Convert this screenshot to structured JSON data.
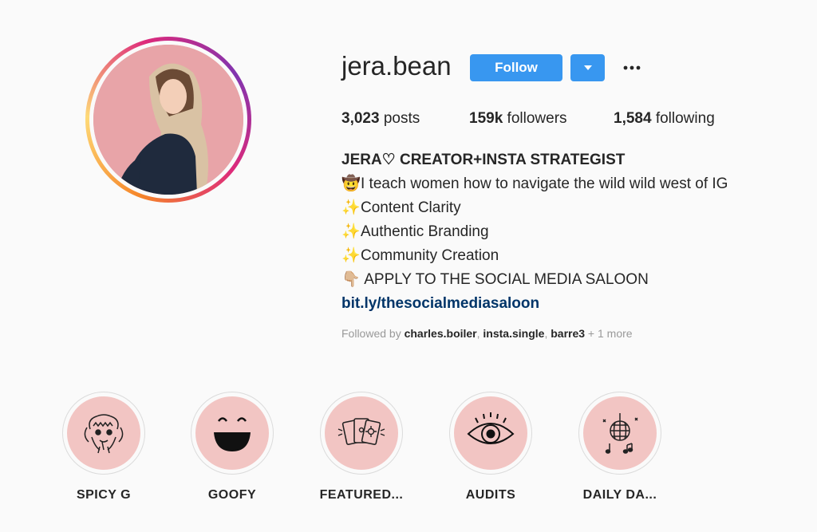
{
  "profile": {
    "username": "jera.bean",
    "follow_label": "Follow",
    "more_icon": "more-dots-icon",
    "avatar_bg": "#e8a4a8"
  },
  "stats": {
    "posts_count": "3,023",
    "posts_label": " posts",
    "followers_count": "159k",
    "followers_label": " followers",
    "following_count": "1,584",
    "following_label": " following"
  },
  "bio": {
    "name": "JERA♡ CREATOR+INSTA STRATEGIST",
    "lines": [
      {
        "emoji": "🤠",
        "text": "I teach women how to navigate the wild wild west of IG"
      },
      {
        "emoji": "✨",
        "text": "Content Clarity"
      },
      {
        "emoji": "✨",
        "text": "Authentic Branding"
      },
      {
        "emoji": "✨",
        "text": "Community Creation"
      },
      {
        "emoji": "👇🏼",
        "text": " APPLY TO THE SOCIAL MEDIA SALOON"
      }
    ],
    "link": "bit.ly/thesocialmediasaloon"
  },
  "followed_by": {
    "prefix": "Followed by ",
    "user1": "charles.boiler",
    "sep1": ", ",
    "user2": "insta.single",
    "sep2": ", ",
    "user3": "barre3",
    "suffix": " + 1 more"
  },
  "highlights": [
    {
      "label": "SPICY G",
      "icon": "dog-sketch-icon"
    },
    {
      "label": "GOOFY",
      "icon": "smiley-face-icon"
    },
    {
      "label": "FEATURED...",
      "icon": "tarot-cards-icon"
    },
    {
      "label": "AUDITS",
      "icon": "eye-icon"
    },
    {
      "label": "DAILY DA...",
      "icon": "disco-ball-icon"
    }
  ],
  "colors": {
    "accent": "#3897f0",
    "highlight_bg": "#f2c5c3",
    "link": "#003569"
  }
}
